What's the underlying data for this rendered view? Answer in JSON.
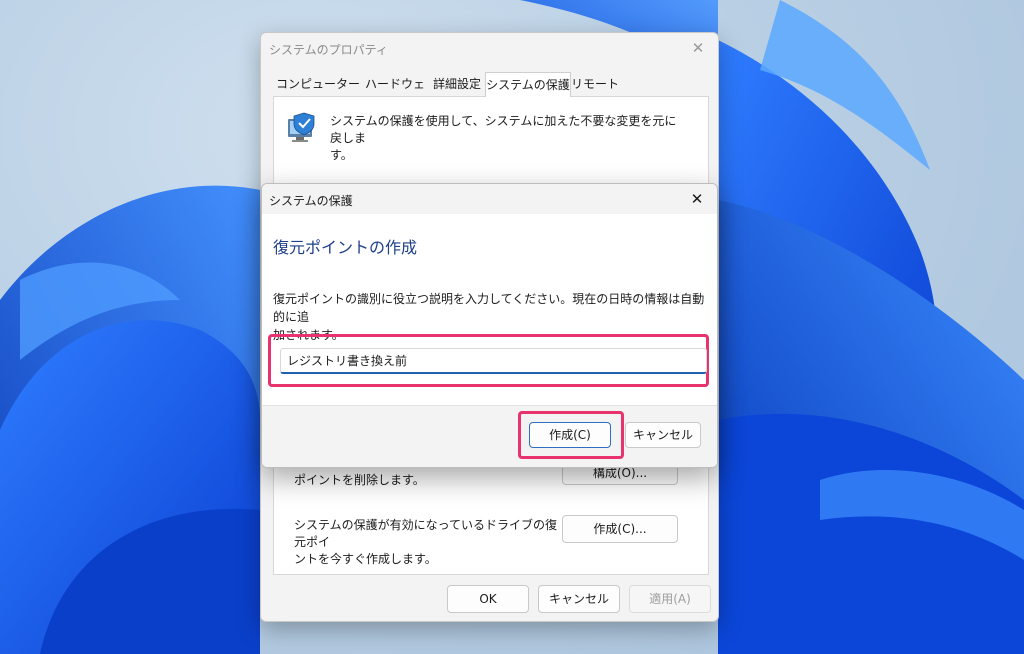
{
  "colors": {
    "accent": "#1f5fb4",
    "highlight": "#e8336f",
    "heading": "#1e3f8a"
  },
  "props_dialog": {
    "title": "システムのプロパティ",
    "tabs": [
      {
        "label": "コンピューター名"
      },
      {
        "label": "ハードウェア"
      },
      {
        "label": "詳細設定"
      },
      {
        "label": "システムの保護",
        "active": true
      },
      {
        "label": "リモート"
      }
    ],
    "description_line1": "システムの保護を使用して、システムに加えた不要な変更を元に戻しま",
    "description_line2": "す。",
    "configure_text_line1": "ポイントを削除します。",
    "configure_button": "構成(O)...",
    "create_text_line1": "システムの保護が有効になっているドライブの復元ポイ",
    "create_text_line2": "ントを今すぐ作成します。",
    "create_button": "作成(C)...",
    "ok_button": "OK",
    "cancel_button": "キャンセル",
    "apply_button": "適用(A)"
  },
  "protect_dialog": {
    "title": "システムの保護",
    "heading": "復元ポイントの作成",
    "instruction_line1": "復元ポイントの識別に役立つ説明を入力してください。現在の日時の情報は自動的に追",
    "instruction_line2": "加されます。",
    "input_value": "レジストリ書き換え前",
    "create_button": "作成(C)",
    "cancel_button": "キャンセル"
  },
  "icons": {
    "close": "close-icon",
    "shield": "system-protection-icon"
  }
}
